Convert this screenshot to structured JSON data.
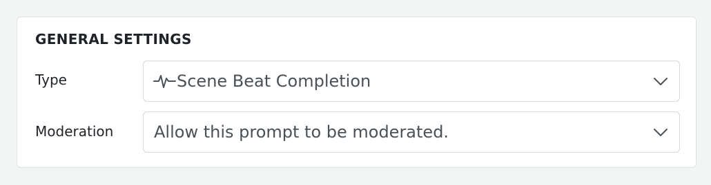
{
  "panel": {
    "title": "GENERAL SETTINGS"
  },
  "fields": {
    "type": {
      "label": "Type",
      "value": "Scene Beat Completion",
      "icon": "activity-pulse-icon"
    },
    "moderation": {
      "label": "Moderation",
      "value": "Allow this prompt to be moderated."
    }
  },
  "colors": {
    "page_background": "#f1f5f4",
    "panel_background": "#ffffff",
    "border": "#d5dadb",
    "text_primary": "#1f2328",
    "text_secondary": "#4b5156"
  }
}
